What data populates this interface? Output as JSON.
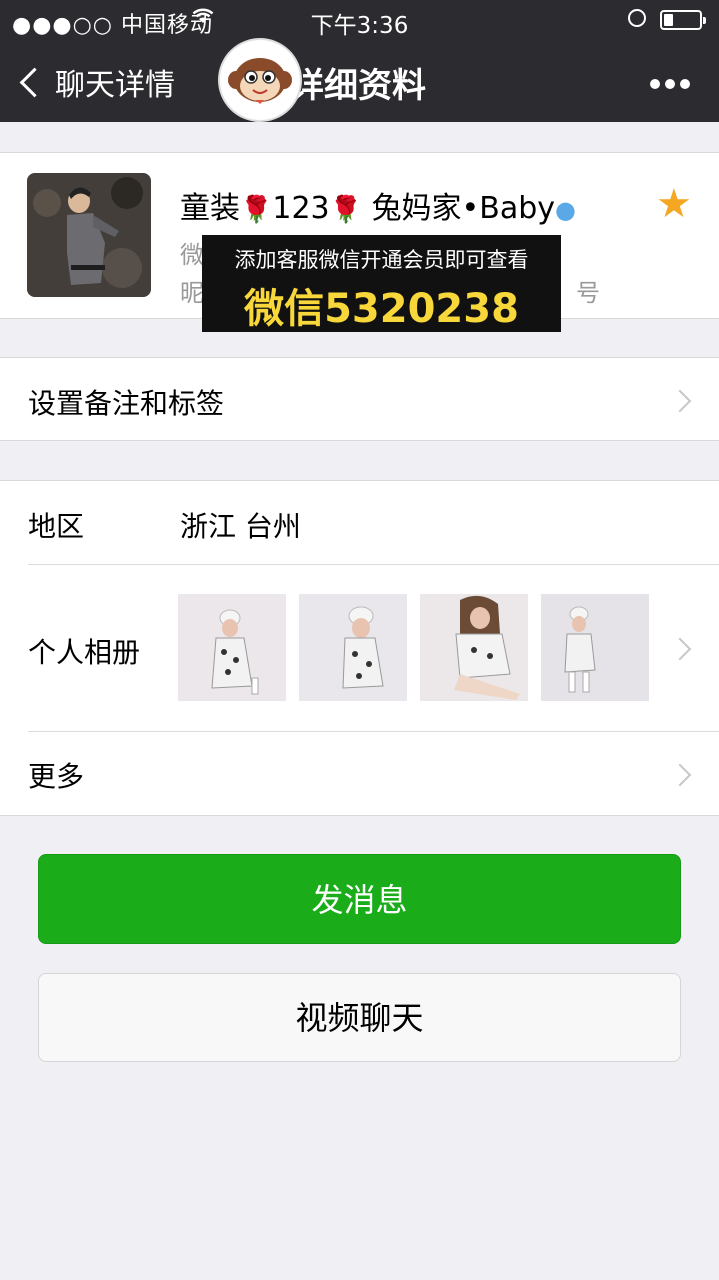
{
  "status_bar": {
    "carrier": "●●●○○ 中国移动",
    "wifi_icon": "wifi-icon",
    "time": "下午3:36",
    "battery_level": 0.25
  },
  "nav": {
    "back_label": "聊天详情",
    "title": "详细资料",
    "more_icon": "more-icon"
  },
  "profile": {
    "name_prefix": "童装",
    "name_mid": "123",
    "name_suffix": "兔妈家•Baby",
    "meta_line1": "微",
    "meta_line2": "昵",
    "meta_line2_suffix": "号",
    "star_icon": "star-icon"
  },
  "overlay": {
    "line1": "添加客服微信开通会员即可查看",
    "line2": "微信5320238"
  },
  "remark_row": {
    "label": "设置备注和标签"
  },
  "region_row": {
    "label": "地区",
    "value": "浙江 台州"
  },
  "album_row": {
    "label": "个人相册",
    "photos": [
      "photo-1",
      "photo-2",
      "photo-3",
      "photo-4"
    ]
  },
  "more_row": {
    "label": "更多"
  },
  "buttons": {
    "send": "发消息",
    "video": "视频聊天"
  },
  "colors": {
    "nav_bg": "#2b2b30",
    "green": "#1aad19",
    "page_bg": "#efeff4",
    "star": "#f5a623",
    "overlay_text": "#f8d73a"
  }
}
